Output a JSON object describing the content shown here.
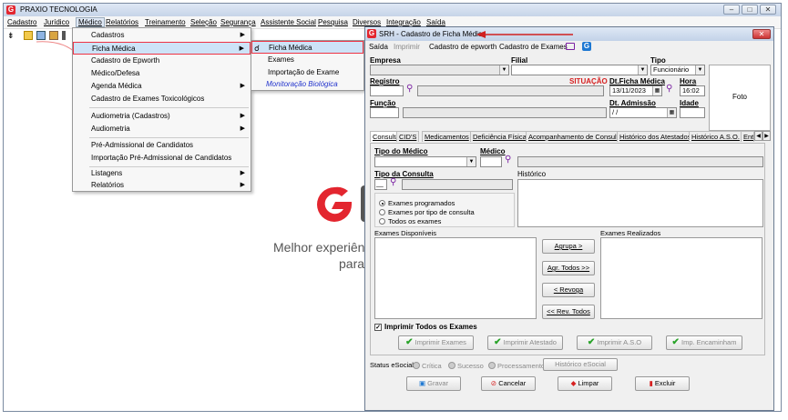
{
  "app": {
    "title": "PRAXIO TECNOLOGIA",
    "logo_letter": "G"
  },
  "menubar": [
    "Cadastro",
    "Jurídico",
    "Médico",
    "Relatórios",
    "Treinamento",
    "Seleção",
    "Segurança",
    "Assistente Social",
    "Pesquisa",
    "Diversos",
    "Integração",
    "Saída"
  ],
  "medico_menu": [
    {
      "label": "Cadastros",
      "arrow": "▶"
    },
    {
      "label": "Ficha Médica",
      "arrow": "▶"
    },
    {
      "label": "Cadastro de Epworth",
      "arrow": ""
    },
    {
      "label": "Médico/Defesa",
      "arrow": ""
    },
    {
      "label": "Agenda Médica",
      "arrow": "▶"
    },
    {
      "label": "Cadastro de Exames Toxicológicos",
      "arrow": ""
    },
    {
      "label": "Audiometria (Cadastros)",
      "arrow": "▶"
    },
    {
      "label": "Audiometria",
      "arrow": "▶"
    },
    {
      "label": "Pré-Admissional de Candidatos",
      "arrow": ""
    },
    {
      "label": "Importação Pré-Admissional de Candidatos",
      "arrow": ""
    },
    {
      "label": "Listagens",
      "arrow": "▶"
    },
    {
      "label": "Relatórios",
      "arrow": "▶"
    }
  ],
  "ficha_submenu": [
    "Ficha Médica",
    "Exames",
    "Importação de Exame",
    "Monitoração Biológica"
  ],
  "brand": {
    "line1": "Melhor experiên",
    "line2": "para"
  },
  "child": {
    "title": "SRH - Cadastro de Ficha Médica",
    "toolbar": [
      "Saída",
      "Imprimir",
      "Cadastro de epworth",
      "Cadastro de Exames"
    ],
    "labels": {
      "empresa": "Empresa",
      "filial": "Filial",
      "tipo": "Tipo",
      "registro": "Registro",
      "situacao": "SITUAÇÃO",
      "dt_ficha": "Dt.Ficha Médica",
      "hora": "Hora",
      "funcao": "Função",
      "dt_admissao": "Dt. Admissão",
      "idade": "Idade",
      "foto": "Foto"
    },
    "values": {
      "tipo": "Funcionário",
      "dt_ficha": "13/11/2023",
      "hora": "16:02",
      "dt_admissao": " / /"
    },
    "tabs": [
      "Consulta",
      "CID'S",
      "Medicamentos",
      "Deficiência Física",
      "Acompanhamento de Consulta",
      "Histórico dos Atestados",
      "Histórico A.S.O.",
      "Ent"
    ],
    "consulta": {
      "tipo_medico": "Tipo do Médico",
      "medico": "Médico",
      "tipo_consulta": "Tipo da Consulta",
      "historico": "Histórico",
      "radios": [
        "Exames programados",
        "Exames por tipo de consulta",
        "Todos os exames"
      ],
      "tipo_consulta_value": "__",
      "exames_disponiveis": "Exames Disponíveis",
      "exames_realizados": "Exames Realizados",
      "buttons": [
        "Agrupa >",
        "Agr. Todos >>",
        "< Revoga",
        "<< Rev. Todos"
      ],
      "imprimir_todos": "Imprimir Todos os Exames",
      "print_buttons": [
        "Imprimir Exames",
        "Imprimir Atestado",
        "Imprimir A.S.O",
        "Imp. Encaminham"
      ]
    },
    "status": {
      "label": "Status eSocial:",
      "items": [
        "Crítica",
        "Sucesso",
        "Processamento"
      ],
      "historico": "Histórico eSocial"
    },
    "footer": [
      "Gravar",
      "Cancelar",
      "Limpar",
      "Excluir"
    ]
  },
  "colors": {
    "accent": "#e3262f",
    "situacao": "#d62020",
    "monitoracao": "#2233cc"
  }
}
